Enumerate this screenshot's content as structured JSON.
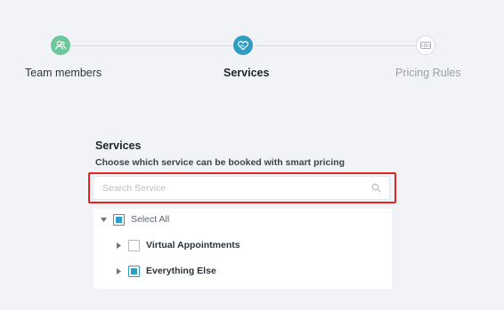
{
  "steps": [
    {
      "label": "Team members",
      "icon": "users-icon",
      "state": "done",
      "color": "#6cc79a"
    },
    {
      "label": "Services",
      "icon": "heart-hand-icon",
      "state": "active",
      "color": "#2f9cc4"
    },
    {
      "label": "Pricing Rules",
      "icon": "money-bill-icon",
      "state": "upcoming",
      "color": "#ffffff"
    }
  ],
  "services": {
    "title": "Services",
    "subtitle": "Choose which service can be booked with smart pricing",
    "search": {
      "placeholder": "Search Service",
      "value": "",
      "icon": "search-icon"
    },
    "tree": {
      "root": {
        "label": "Select All",
        "expanded": true,
        "checked": "partial"
      },
      "children": [
        {
          "label": "Virtual Appointments",
          "expanded": false,
          "checked": "unchecked"
        },
        {
          "label": "Everything Else",
          "expanded": false,
          "checked": "partial"
        }
      ]
    }
  },
  "colors": {
    "accent": "#2f9cc4",
    "highlight_outline": "#e3251e",
    "step_done": "#6cc79a"
  }
}
